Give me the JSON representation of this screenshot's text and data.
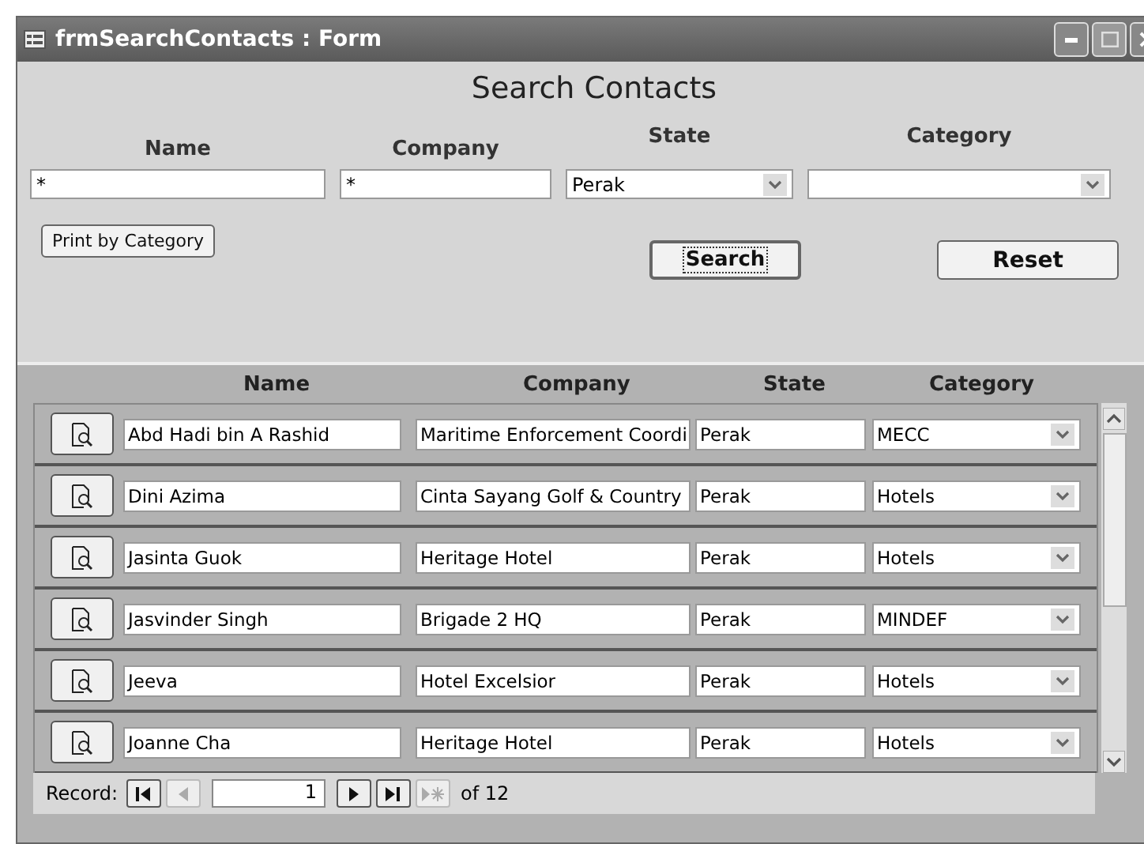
{
  "window": {
    "title": "frmSearchContacts : Form"
  },
  "header": {
    "title": "Search Contacts"
  },
  "filters": [
    {
      "label": "Name",
      "kind": "text",
      "value": "*"
    },
    {
      "label": "Company",
      "kind": "text",
      "value": "*"
    },
    {
      "label": "State",
      "kind": "combo",
      "value": "Perak"
    },
    {
      "label": "Category",
      "kind": "combo"
    }
  ],
  "print_button": "Print by Category",
  "search_button": "Search",
  "reset_button": "Reset",
  "columns": [
    "Name",
    "Company",
    "State",
    "Category"
  ],
  "rows": [
    {
      "name": "Abd Hadi bin A Rashid",
      "company": "Maritime Enforcement Coordi",
      "state": "Perak",
      "category": "MECC"
    },
    {
      "name": "Dini Azima",
      "company": "Cinta Sayang Golf & Country",
      "state": "Perak",
      "category": "Hotels"
    },
    {
      "name": "Jasinta Guok",
      "company": "Heritage Hotel",
      "state": "Perak",
      "category": "Hotels"
    },
    {
      "name": "Jasvinder Singh",
      "company": "Brigade 2 HQ",
      "state": "Perak",
      "category": "MINDEF"
    },
    {
      "name": "Jeeva",
      "company": "Hotel Excelsior",
      "state": "Perak",
      "category": "Hotels"
    },
    {
      "name": "Joanne Cha",
      "company": "Heritage Hotel",
      "state": "Perak",
      "category": "Hotels"
    }
  ],
  "record_nav": {
    "label": "Record:",
    "current": "1",
    "total": "of 12"
  }
}
